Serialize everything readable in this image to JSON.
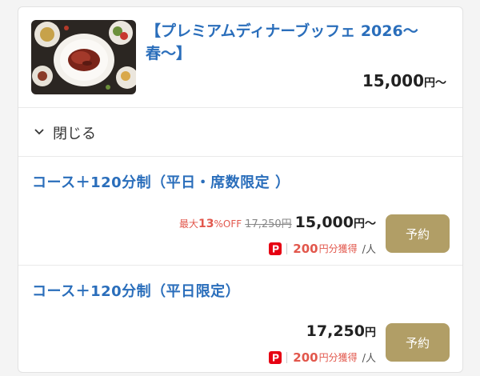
{
  "plan": {
    "title": "【プレミアムディナーブッフェ 2026〜春〜】",
    "price_value": "15,000",
    "price_unit": "円〜",
    "image": "buffet-roast-beef-photo"
  },
  "toggle": {
    "label": "閉じる",
    "icon": "chevron-down-icon"
  },
  "courses": [
    {
      "title": "コース＋120分制（平日・席数限定 ）",
      "discount_prefix": "最大",
      "discount_value": "13",
      "discount_suffix": "%OFF",
      "original_price": "17,250円",
      "price_value": "15,000",
      "price_unit": "円〜",
      "points_value": "200",
      "points_suffix": "円分獲得",
      "per_person": "/人",
      "reserve_label": "予約"
    },
    {
      "title": "コース＋120分制（平日限定）",
      "price_value": "17,250",
      "price_unit": "円",
      "points_value": "200",
      "points_suffix": "円分獲得",
      "per_person": "/人",
      "reserve_label": "予約"
    }
  ],
  "colors": {
    "link_blue": "#2a6ebb",
    "accent_red": "#e2574c",
    "button_gold": "#b19e66",
    "paypay_red": "#e60012"
  }
}
